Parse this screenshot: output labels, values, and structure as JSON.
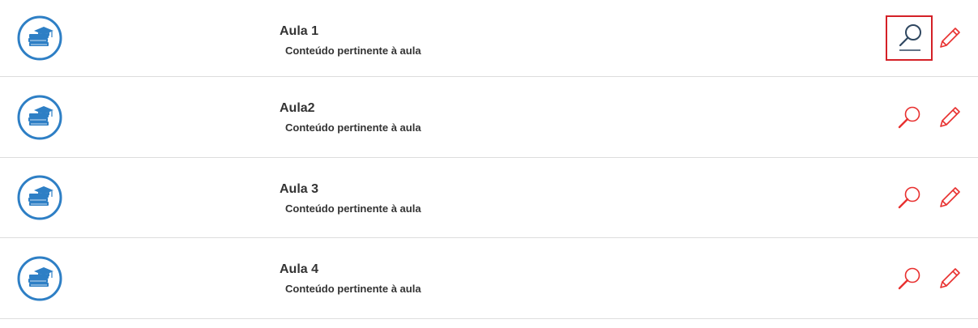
{
  "colors": {
    "accent_blue": "#2e7fc5",
    "action_red": "#e8302f",
    "selected_border": "#d42027",
    "selected_icon": "#2f4760",
    "text": "#333333",
    "divider": "#dddddd"
  },
  "lessons": [
    {
      "title": "Aula 1",
      "description": "Conteúdo pertinente à aula",
      "icon": "graduation-books-icon",
      "actions": {
        "view": "magnifier-icon",
        "edit": "pencil-icon"
      },
      "selected": true
    },
    {
      "title": "Aula2",
      "description": "Conteúdo pertinente à aula",
      "icon": "graduation-books-icon",
      "actions": {
        "view": "magnifier-icon",
        "edit": "pencil-icon"
      },
      "selected": false
    },
    {
      "title": "Aula 3",
      "description": "Conteúdo pertinente à aula",
      "icon": "graduation-books-icon",
      "actions": {
        "view": "magnifier-icon",
        "edit": "pencil-icon"
      },
      "selected": false
    },
    {
      "title": "Aula 4",
      "description": "Conteúdo pertinente à aula",
      "icon": "graduation-books-icon",
      "actions": {
        "view": "magnifier-icon",
        "edit": "pencil-icon"
      },
      "selected": false
    }
  ]
}
